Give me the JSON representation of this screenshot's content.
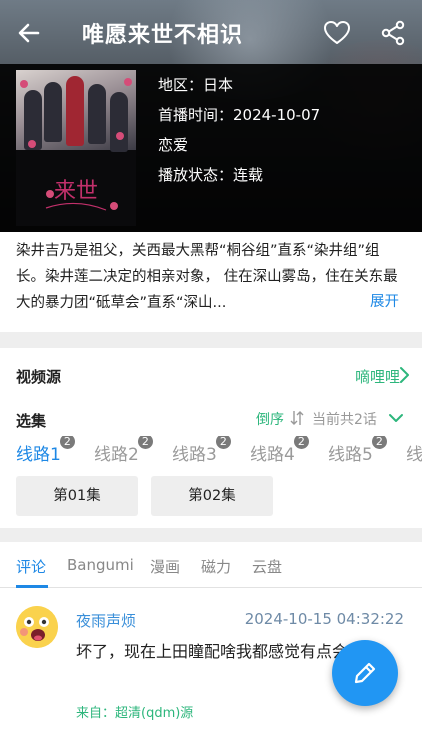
{
  "header": {
    "title": "唯愿来世不相识",
    "icons": {
      "back": "arrow-left-icon",
      "favorite": "heart-outline-icon",
      "share": "share-icon"
    }
  },
  "cover": {
    "logo_text": "来世"
  },
  "info": {
    "region": "地区：日本",
    "air_date": "首播时间：2024-10-07",
    "genre": "恋爱",
    "status": "播放状态：连载"
  },
  "synopsis": {
    "text": "染井吉乃是祖父，关西最大黑帮“桐谷组”直系“染井组”组长。染井莲二决定的相亲对象， 住在深山雾岛，住在关东最大的暴力团“砥草会”直系“深山...",
    "expand_label": "展开"
  },
  "source": {
    "label": "视频源",
    "value": "嘀哩哩"
  },
  "episodes": {
    "label": "选集",
    "sort_label": "倒序",
    "total_label": "当前共2话",
    "lines": [
      {
        "label": "线路1",
        "badge": "2"
      },
      {
        "label": "线路2",
        "badge": "2"
      },
      {
        "label": "线路3",
        "badge": "2"
      },
      {
        "label": "线路4",
        "badge": "2"
      },
      {
        "label": "线路5",
        "badge": "2"
      },
      {
        "label": "线"
      }
    ],
    "items": [
      "第01集",
      "第02集"
    ]
  },
  "tabs": [
    "评论",
    "Bangumi",
    "漫画",
    "磁力",
    "云盘"
  ],
  "comment": {
    "user": "夜雨声烦",
    "time": "2024-10-15 04:32:22",
    "text": "坏了，现在上田瞳配啥我都感觉有点会船了",
    "source": "来自：超清(qdm)源"
  },
  "colors": {
    "accent_blue": "#1e88e5",
    "accent_green": "#2db67c",
    "fab": "#2196f3"
  }
}
